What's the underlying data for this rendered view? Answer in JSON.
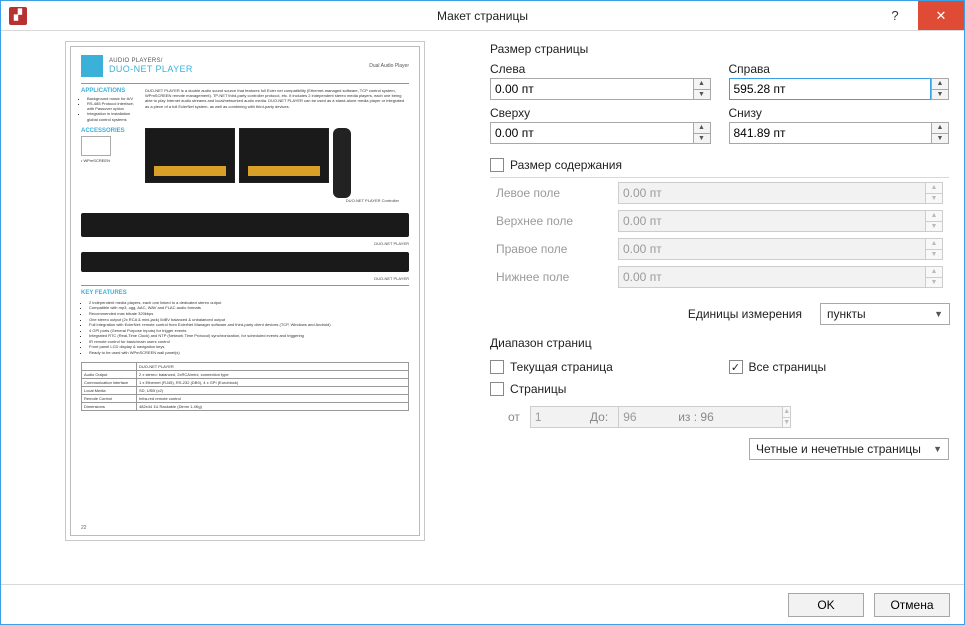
{
  "window": {
    "title": "Макет страницы",
    "appicon_glyph": "▞"
  },
  "preview": {
    "header_small": "AUDIO PLAYERS/",
    "header_big": "DUO-NET PLAYER",
    "header_right": "Dual Audio Player",
    "sec_applications": "APPLICATIONS",
    "sec_accessories": "ACCESSORIES",
    "sec_features": "KEY FEATURES",
    "acc_code": "• WPmSCREEN",
    "app_items": [
      "Background music for A/V",
      "RS-485 Protocol interface, with Passover option",
      "Integration in installation global control systems"
    ],
    "body_text": "DUO-NET PLAYER is a double audio sound source that features full Ecler net compatibility (Ethernet-managed software, TCP control system, WPmSCREEN remote management). TP-NET third-party controller protocol, etc. It includes 2 independent stereo media players, each one being able to play Internet audio streams and local/networked audio media.\nDUO-NET PLAYER can be used as a stand-alone media player or integrated as a piece of a full EclerNet system, as well as combining with third-party devices.",
    "caption1": "DUO-NET PLAYER Controller",
    "caption2": "DUO-NET PLAYER",
    "feat_items": [
      "2 independent media players, each one linked to a dedicated stereo output",
      "Compatible with mp3, ogg, AAC, WAV and FLAC audio formats",
      "Recommended max bitrate 320kbps",
      "One stereo output (2x RCA & mini-jack) 0dBV balanced & unbalanced output",
      "Full integration with EclerNet: remote control from EclerNet Manager software and third-party client devices (TCP, Windows and Android)",
      "4 GPI ports (General Purpose Inputs) for trigger events",
      "Integrated RTC (Real-Time Clock) and NTP (Network Time Protocol) synchronization, for scheduled events and triggering",
      "IR remote control for basic/main users control",
      "Front panel LCD display & navigation keys",
      "Ready to be used with WPmSCREEN wall panel(s)"
    ],
    "table": [
      [
        "Audio Output",
        "2 x stereo: balanced, 2xRCA/mini, connection type"
      ],
      [
        "Communication interface",
        "1 x Ethernet (RJ45), RS-232 (DB9), 4 x GPI (Euroblock)"
      ],
      [
        "Local Media",
        "SD, USB (x2)"
      ],
      [
        "Remote Control",
        "Infra-red remote control"
      ],
      [
        "Dimensions",
        "482x44 1U Rackable (Dimm 1.4Kg)"
      ]
    ],
    "table_header": "DUO-NET PLAYER",
    "page_number": "22"
  },
  "size": {
    "title": "Размер страницы",
    "left_label": "Слева",
    "right_label": "Справа",
    "top_label": "Сверху",
    "bottom_label": "Снизу",
    "left_value": "0.00 пт",
    "right_value": "595.28 пт",
    "top_value": "0.00 пт",
    "bottom_value": "841.89 пт"
  },
  "content_size": {
    "checkbox_label": "Размер содержания",
    "left_label": "Левое поле",
    "top_label": "Верхнее поле",
    "right_label": "Правое поле",
    "bottom_label": "Нижнее поле",
    "left_value": "0.00 пт",
    "top_value": "0.00 пт",
    "right_value": "0.00 пт",
    "bottom_value": "0.00 пт"
  },
  "units": {
    "label": "Единицы измерения",
    "value": "пункты"
  },
  "range": {
    "title": "Диапазон страниц",
    "current_label": "Текущая страница",
    "all_label": "Все страницы",
    "pages_label": "Страницы",
    "from_label": "от",
    "from_value": "1",
    "to_label": "До:",
    "to_value": "96",
    "of_label": "из : 96",
    "parity_value": "Четные и нечетные страницы"
  },
  "buttons": {
    "ok": "OK",
    "cancel": "Отмена"
  },
  "checkmark": "✓"
}
